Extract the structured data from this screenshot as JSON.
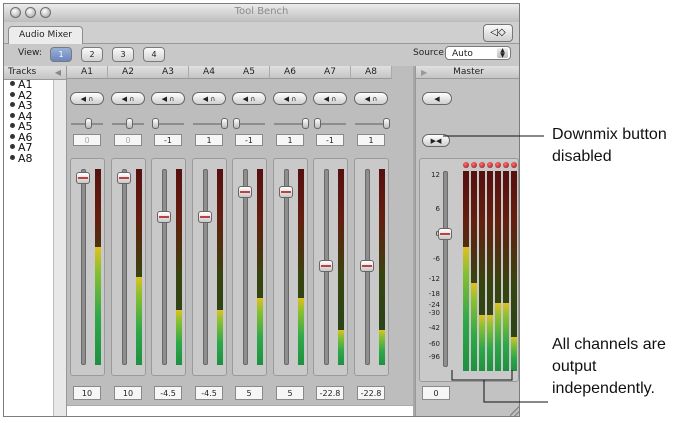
{
  "window": {
    "title": "Tool Bench",
    "tab": "Audio Mixer"
  },
  "toolbar": {
    "view_label": "View:",
    "view_buttons": [
      "1",
      "2",
      "3",
      "4"
    ],
    "active_view": "1",
    "source_label": "Source:",
    "source_value": "Auto"
  },
  "tracks": {
    "header": "Tracks",
    "items": [
      "A1",
      "A2",
      "A3",
      "A4",
      "A5",
      "A6",
      "A7",
      "A8"
    ]
  },
  "channels": [
    {
      "name": "A1",
      "pan": "0",
      "pan_dim": true,
      "volume": "10",
      "level": 0.6
    },
    {
      "name": "A2",
      "pan": "0",
      "pan_dim": true,
      "volume": "10",
      "level": 0.45
    },
    {
      "name": "A3",
      "pan": "-1",
      "pan_dim": false,
      "volume": "-4.5",
      "level": 0.28
    },
    {
      "name": "A4",
      "pan": "1",
      "pan_dim": false,
      "volume": "-4.5",
      "level": 0.28
    },
    {
      "name": "A5",
      "pan": "-1",
      "pan_dim": false,
      "volume": "5",
      "level": 0.34
    },
    {
      "name": "A6",
      "pan": "1",
      "pan_dim": false,
      "volume": "5",
      "level": 0.34
    },
    {
      "name": "A7",
      "pan": "-1",
      "pan_dim": false,
      "volume": "-22.8",
      "level": 0.18
    },
    {
      "name": "A8",
      "pan": "1",
      "pan_dim": false,
      "volume": "-22.8",
      "level": 0.18
    }
  ],
  "master": {
    "header": "Master",
    "volume": "0",
    "scale": [
      "12",
      "6",
      "0",
      "-6",
      "-12",
      "-18",
      "-24",
      "-30",
      "-42",
      "-60",
      "-96"
    ],
    "meters": [
      0.62,
      0.44,
      0.28,
      0.28,
      0.34,
      0.34,
      0.17,
      0.17
    ]
  },
  "annotations": {
    "downmix": [
      "Downmix button",
      "disabled"
    ],
    "channels": [
      "All channels are",
      "output",
      "independently."
    ]
  },
  "colors": {
    "window_bg": "#c8c8c8",
    "meter_green": "#2ea84a",
    "meter_red": "#5a1010",
    "active_view": "#6a86c0"
  },
  "icons": {
    "mute": "speaker-icon",
    "solo": "headphones-icon",
    "downmix": "downmix-icon"
  }
}
